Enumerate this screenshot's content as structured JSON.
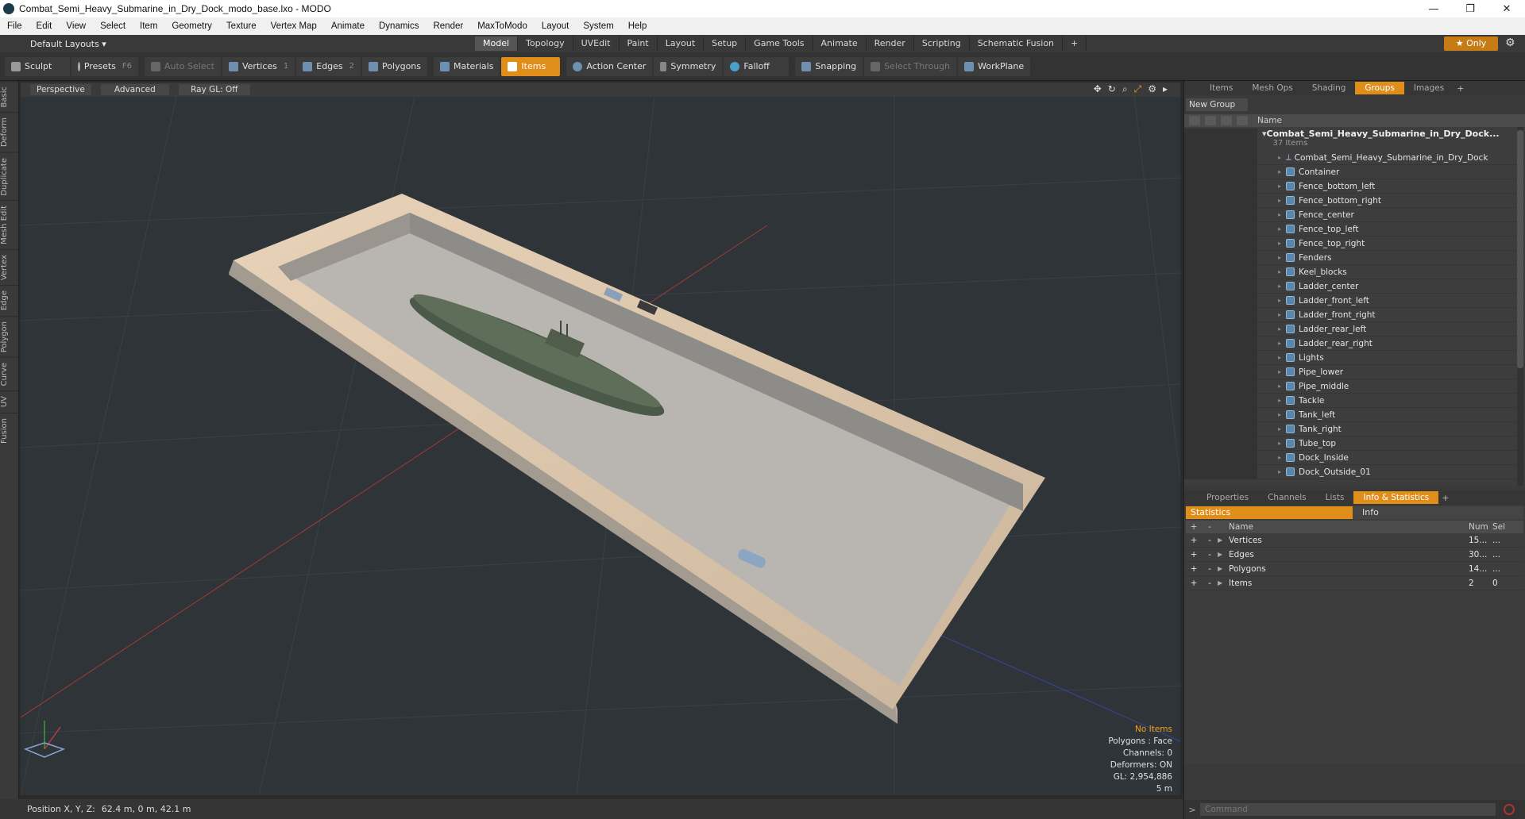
{
  "window": {
    "title": "Combat_Semi_Heavy_Submarine_in_Dry_Dock_modo_base.lxo - MODO"
  },
  "menu": [
    "File",
    "Edit",
    "View",
    "Select",
    "Item",
    "Geometry",
    "Texture",
    "Vertex Map",
    "Animate",
    "Dynamics",
    "Render",
    "MaxToModo",
    "Layout",
    "System",
    "Help"
  ],
  "layoutbar": {
    "layout": "Default Layouts ▾",
    "tabs": [
      "Model",
      "Topology",
      "UVEdit",
      "Paint",
      "Layout",
      "Setup",
      "Game Tools",
      "Animate",
      "Render",
      "Scripting",
      "Schematic Fusion"
    ],
    "active_tab": "Model",
    "only": "★ Only"
  },
  "toolbar": {
    "sculpt": "Sculpt",
    "presets": "Presets",
    "presets_key": "F6",
    "auto_select": "Auto Select",
    "vertices": "Vertices",
    "vertices_count": "1",
    "edges": "Edges",
    "edges_count": "2",
    "polygons": "Polygons",
    "materials": "Materials",
    "items": "Items",
    "action_center": "Action Center",
    "symmetry": "Symmetry",
    "falloff": "Falloff",
    "snapping": "Snapping",
    "select_through": "Select Through",
    "workplane": "WorkPlane"
  },
  "left_tabs": [
    "Basic",
    "Deform",
    "Duplicate",
    "Mesh Edit",
    "Vertex",
    "Edge",
    "Polygon",
    "Curve",
    "UV",
    "Fusion"
  ],
  "viewport": {
    "perspective": "Perspective",
    "advanced": "Advanced",
    "raygl": "Ray GL: Off",
    "hud": {
      "no_items": "No Items",
      "polygons": "Polygons : Face",
      "channels": "Channels: 0",
      "deformers": "Deformers: ON",
      "gl": "GL: 2,954,886",
      "scale": "5 m"
    }
  },
  "status": {
    "label": "Position X, Y, Z:",
    "value": "62.4 m, 0 m, 42.1 m"
  },
  "right_top": {
    "tabs": [
      "Items",
      "Mesh Ops",
      "Shading",
      "Groups",
      "Images"
    ],
    "active_tab": "Groups",
    "new_group": "New Group",
    "col_name": "Name",
    "group_title": "Combat_Semi_Heavy_Submarine_in_Dry_Dock...",
    "group_sub": "37 Items",
    "items": [
      "Combat_Semi_Heavy_Submarine_in_Dry_Dock",
      "Container",
      "Fence_bottom_left",
      "Fence_bottom_right",
      "Fence_center",
      "Fence_top_left",
      "Fence_top_right",
      "Fenders",
      "Keel_blocks",
      "Ladder_center",
      "Ladder_front_left",
      "Ladder_front_right",
      "Ladder_rear_left",
      "Ladder_rear_right",
      "Lights",
      "Pipe_lower",
      "Pipe_middle",
      "Tackle",
      "Tank_left",
      "Tank_right",
      "Tube_top",
      "Dock_Inside",
      "Dock_Outside_01"
    ]
  },
  "right_bottom": {
    "tabs": [
      "Properties",
      "Channels",
      "Lists",
      "Info & Statistics"
    ],
    "active_tab": "Info & Statistics",
    "sub_statistics": "Statistics",
    "sub_info": "Info",
    "col_name": "Name",
    "col_num": "Num",
    "col_sel": "Sel",
    "rows": [
      {
        "name": "Vertices",
        "num": "15...",
        "sel": "..."
      },
      {
        "name": "Edges",
        "num": "30...",
        "sel": "..."
      },
      {
        "name": "Polygons",
        "num": "14...",
        "sel": "..."
      },
      {
        "name": "Items",
        "num": "2",
        "sel": "0"
      }
    ]
  },
  "command": {
    "placeholder": "Command"
  }
}
